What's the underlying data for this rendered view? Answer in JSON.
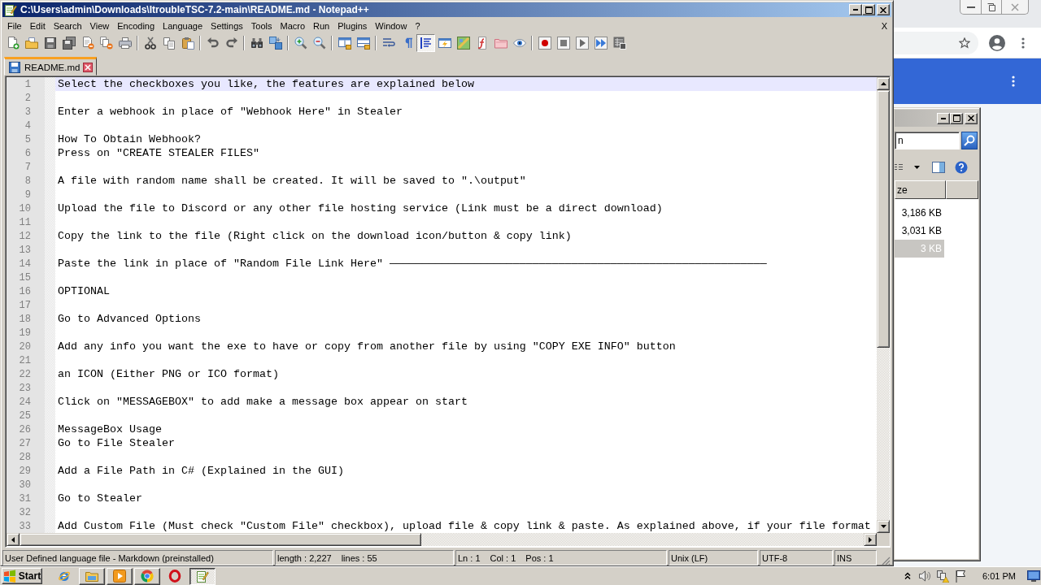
{
  "window": {
    "title": "C:\\Users\\admin\\Downloads\\ItroubleTSC-7.2-main\\README.md - Notepad++"
  },
  "menu": {
    "items": [
      "File",
      "Edit",
      "Search",
      "View",
      "Encoding",
      "Language",
      "Settings",
      "Tools",
      "Macro",
      "Run",
      "Plugins",
      "Window",
      "?"
    ],
    "close_label": "X"
  },
  "toolbar": [
    {
      "pressed": false
    },
    {
      "pressed": false
    },
    {
      "pressed": false
    },
    {
      "pressed": false
    },
    {
      "pressed": false
    },
    {
      "pressed": false
    },
    {
      "pressed": false
    },
    {
      "pressed": false
    },
    {
      "pressed": false
    },
    {
      "pressed": false
    },
    {
      "pressed": false
    },
    {
      "pressed": false
    },
    {
      "pressed": false
    },
    {
      "pressed": false
    },
    {
      "pressed": false
    },
    {
      "pressed": false
    },
    {
      "pressed": false
    },
    {
      "pressed": false
    },
    {
      "pressed": false
    },
    {
      "pressed": false
    },
    {
      "pressed": true
    },
    {
      "pressed": false
    },
    {
      "pressed": false
    },
    {
      "pressed": false
    },
    {
      "pressed": false
    },
    {
      "pressed": false
    },
    {
      "pressed": false
    },
    {
      "pressed": false
    },
    {
      "pressed": false
    },
    {
      "pressed": false
    },
    {
      "pressed": false
    }
  ],
  "tabs": [
    {
      "label": "README.md",
      "selected": true
    }
  ],
  "editor": {
    "lines": [
      {
        "number": "1",
        "text": "Select the checkboxes you like, the features are explained below",
        "current": true
      },
      {
        "number": "2",
        "current": false
      },
      {
        "number": "3",
        "text": "Enter a webhook in place of \"Webhook Here\" in Stealer",
        "current": false
      },
      {
        "number": "4",
        "current": false
      },
      {
        "number": "5",
        "text": "How To Obtain Webhook?",
        "current": false
      },
      {
        "number": "6",
        "text": "Press on \"CREATE STEALER FILES\"",
        "current": false
      },
      {
        "number": "7",
        "current": false
      },
      {
        "number": "8",
        "text": "A file with random name shall be created. It will be saved to \".\\output\"",
        "current": false
      },
      {
        "number": "9",
        "current": false
      },
      {
        "number": "10",
        "text": "Upload the file to Discord or any other file hosting service (Link must be a direct download)",
        "current": false
      },
      {
        "number": "11",
        "current": false
      },
      {
        "number": "12",
        "text": "Copy the link to the file (Right click on the download icon/button & copy link)",
        "current": false
      },
      {
        "number": "13",
        "current": false
      },
      {
        "number": "14",
        "text": "Paste the link in place of \"Random File Link Here\" ——————————————————————————————————————————————————————————",
        "current": false
      },
      {
        "number": "15",
        "current": false
      },
      {
        "number": "16",
        "text": "OPTIONAL",
        "current": false
      },
      {
        "number": "17",
        "current": false
      },
      {
        "number": "18",
        "text": "Go to Advanced Options",
        "current": false
      },
      {
        "number": "19",
        "current": false
      },
      {
        "number": "20",
        "text": "Add any info you want the exe to have or copy from another file by using \"COPY EXE INFO\" button",
        "current": false
      },
      {
        "number": "21",
        "current": false
      },
      {
        "number": "22",
        "text": "an ICON (Either PNG or ICO format)",
        "current": false
      },
      {
        "number": "23",
        "current": false
      },
      {
        "number": "24",
        "text": "Click on \"MESSAGEBOX\" to add make a message box appear on start",
        "current": false
      },
      {
        "number": "25",
        "current": false
      },
      {
        "number": "26",
        "text": "MessageBox Usage",
        "current": false
      },
      {
        "number": "27",
        "text": "Go to File Stealer",
        "current": false
      },
      {
        "number": "28",
        "current": false
      },
      {
        "number": "29",
        "text": "Add a File Path in C# (Explained in the GUI)",
        "current": false
      },
      {
        "number": "30",
        "current": false
      },
      {
        "number": "31",
        "text": "Go to Stealer",
        "current": false
      },
      {
        "number": "32",
        "current": false
      },
      {
        "number": "33",
        "text": "Add Custom File (Must check \"Custom File\" checkbox), upload file & copy link & paste. As explained above, if your file format",
        "current": false
      }
    ]
  },
  "status_bar": {
    "panels": [
      {
        "parts": [
          "User Defined language file - Markdown (preinstalled)"
        ]
      },
      {
        "parts": [
          "length : 2,227",
          "lines : 55"
        ]
      },
      {
        "parts": [
          "Ln : 1",
          "Col : 1",
          "Pos : 1"
        ]
      },
      {
        "parts": [
          "Unix (LF)"
        ]
      },
      {
        "parts": [
          "UTF-8"
        ]
      },
      {
        "parts": [
          "INS"
        ]
      }
    ]
  },
  "explorer_window": {
    "search": {
      "value": "n"
    },
    "columns": [
      {
        "label": "ze"
      }
    ],
    "rows": [
      {
        "cells": [
          "3,186 KB"
        ],
        "selected": false
      },
      {
        "cells": [
          "3,031 KB"
        ],
        "selected": false
      },
      {
        "cells": [
          "3 KB"
        ],
        "selected": true
      }
    ]
  },
  "taskbar": {
    "start_label": "Start",
    "items": [
      {
        "running": false,
        "active": false
      },
      {
        "running": true,
        "active": false
      },
      {
        "running": true,
        "active": false
      },
      {
        "running": true,
        "active": false
      },
      {
        "running": false,
        "active": false
      },
      {
        "running": true,
        "active": true
      }
    ],
    "clock": "6:01 PM"
  }
}
